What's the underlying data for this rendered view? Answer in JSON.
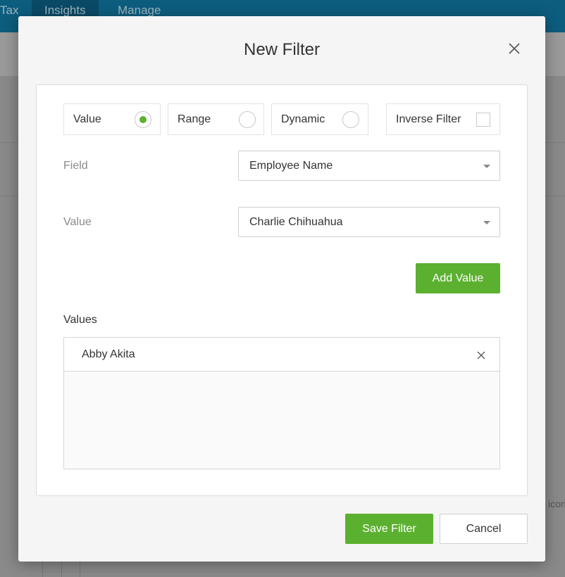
{
  "background": {
    "tabs": [
      "Tax",
      "Insights",
      "Manage"
    ],
    "active_tab": "Insights",
    "fragment_text": "icon"
  },
  "modal": {
    "title": "New Filter",
    "close_icon": "close-icon"
  },
  "filter_types": {
    "value_label": "Value",
    "range_label": "Range",
    "dynamic_label": "Dynamic",
    "selected": "Value",
    "inverse_label": "Inverse Filter",
    "inverse_checked": false
  },
  "field": {
    "label": "Field",
    "selected": "Employee Name"
  },
  "value": {
    "label": "Value",
    "selected": "Charlie Chihuahua"
  },
  "add_value_label": "Add Value",
  "values": {
    "title": "Values",
    "items": [
      "Abby Akita"
    ]
  },
  "footer": {
    "save_label": "Save Filter",
    "cancel_label": "Cancel"
  },
  "colors": {
    "accent_green": "#5cb030",
    "top_bar": "#0d5d7e"
  }
}
